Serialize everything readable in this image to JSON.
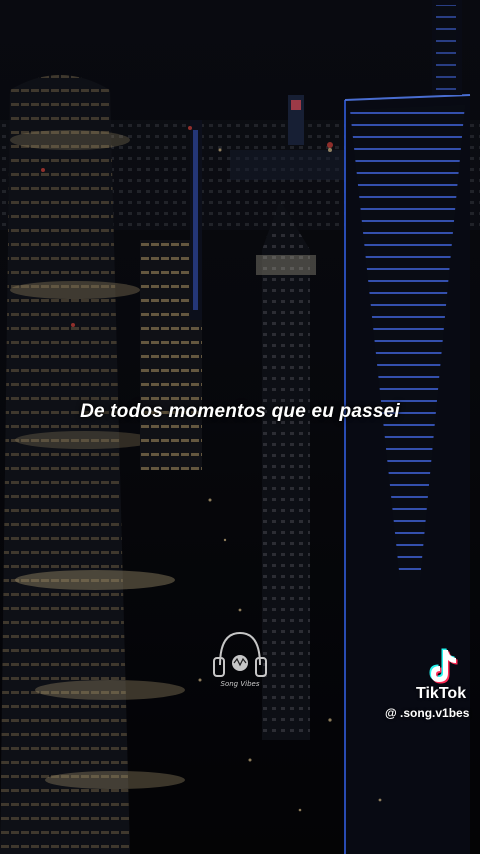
{
  "video": {
    "lyric_line": "De todos momentos que eu passei"
  },
  "logo": {
    "label": "Song Vibes",
    "icon": "headphones-icon"
  },
  "watermark": {
    "brand": "TikTok",
    "handle": "@ .song.v1bes",
    "icon": "tiktok-note-icon"
  },
  "colors": {
    "background": "#07080c",
    "tower_glow": "#3a6cff",
    "window_light": "#f2d59a",
    "text": "#ffffff"
  }
}
